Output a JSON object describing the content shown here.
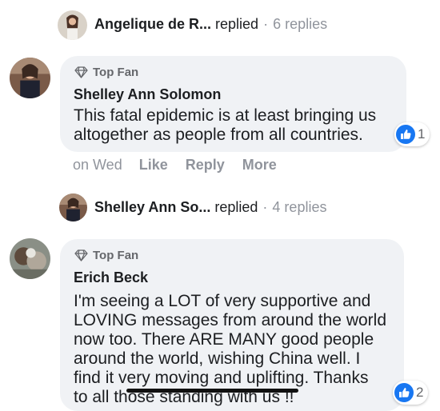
{
  "thread1": {
    "name": "Angelique de R...",
    "verb": "replied",
    "separator": "·",
    "count": "6 replies"
  },
  "comment1": {
    "badge": "Top Fan",
    "author": "Shelley Ann Solomon",
    "lines": [
      "This fatal epidemic is at least bringing us",
      "altogether as people from all countries."
    ],
    "likes": "1"
  },
  "actions": {
    "time": "on Wed",
    "like": "Like",
    "reply": "Reply",
    "more": "More"
  },
  "thread2": {
    "name": "Shelley Ann So...",
    "verb": "replied",
    "separator": "·",
    "count": "4 replies"
  },
  "comment2": {
    "badge": "Top Fan",
    "author": "Erich Beck",
    "lines": [
      "I'm seeing a LOT of very supportive and",
      "LOVING messages from around the world",
      "now too. There ARE MANY good people",
      "around the world, wishing China well. I",
      "find it very moving and uplifting. Thanks",
      "to all those standing with us !!"
    ],
    "likes": "2"
  },
  "colors": {
    "bubble": "#f0f2f5",
    "like_blue": "#1877f2",
    "muted": "#90949c"
  },
  "icons": [
    "diamond-icon",
    "thumbs-up-icon"
  ]
}
